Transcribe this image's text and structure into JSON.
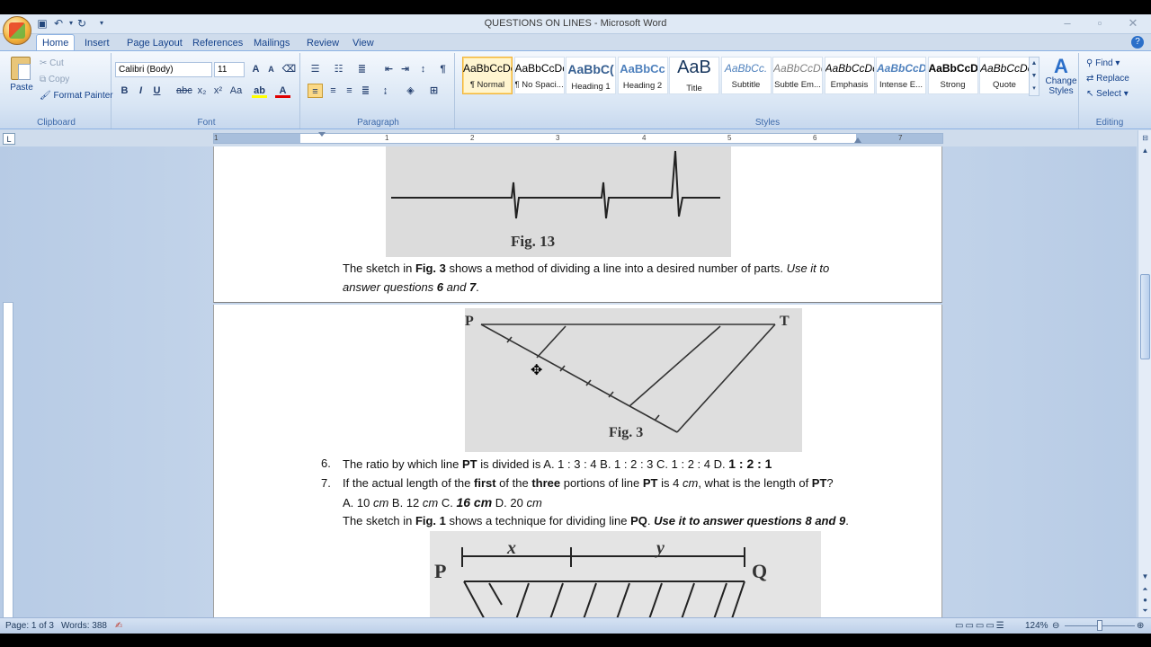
{
  "window": {
    "title": "QUESTIONS ON LINES - Microsoft Word"
  },
  "ribbon_tabs": [
    "Home",
    "Insert",
    "Page Layout",
    "References",
    "Mailings",
    "Review",
    "View"
  ],
  "clipboard": {
    "paste": "Paste",
    "cut": "Cut",
    "copy": "Copy",
    "format_painter": "Format Painter",
    "label": "Clipboard"
  },
  "font": {
    "family": "Calibri (Body)",
    "size": "11",
    "label": "Font"
  },
  "paragraph": {
    "label": "Paragraph"
  },
  "styles": {
    "label": "Styles",
    "items": [
      {
        "sample": "AaBbCcDc",
        "name": "¶ Normal"
      },
      {
        "sample": "AaBbCcDc",
        "name": "¶ No Spaci..."
      },
      {
        "sample": "AaBbC(",
        "name": "Heading 1"
      },
      {
        "sample": "AaBbCc",
        "name": "Heading 2"
      },
      {
        "sample": "AaB",
        "name": "Title"
      },
      {
        "sample": "AaBbCc.",
        "name": "Subtitle"
      },
      {
        "sample": "AaBbCcDc",
        "name": "Subtle Em..."
      },
      {
        "sample": "AaBbCcDc",
        "name": "Emphasis"
      },
      {
        "sample": "AaBbCcDc",
        "name": "Intense E..."
      },
      {
        "sample": "AaBbCcDc",
        "name": "Strong"
      },
      {
        "sample": "AaBbCcDc",
        "name": "Quote"
      }
    ],
    "change_styles": "Change Styles"
  },
  "editing": {
    "find": "Find",
    "replace": "Replace",
    "select": "Select",
    "label": "Editing"
  },
  "document": {
    "fig13_caption": "Fig. 13",
    "line1": {
      "a": "The sketch in ",
      "b": "Fig. 3",
      "c": " shows a method of dividing  a line into a desired number  of parts. ",
      "d": "Use it to"
    },
    "line2": {
      "a": "answer questions ",
      "b": "6",
      "c": " and ",
      "d": "7",
      "e": "."
    },
    "fig3_caption": "Fig. 3",
    "fig3_P": "P",
    "fig3_T": "T",
    "q6": {
      "num": "6.",
      "a": "The ratio by which line ",
      "b": "PT",
      "c": " is divided is A. 1 : 3 : 4 B. 1 : 2 : 3 C. 1 : 2 : 4 D. ",
      "d": "1 : 2 : 1"
    },
    "q7": {
      "num": "7.",
      "a": "If the actual length of the ",
      "b": "first",
      "c": " of the ",
      "d": "three",
      "e": " portions  of line ",
      "f": "PT",
      "g": " is 4 ",
      "h": "cm",
      "i": ", what is the length  of ",
      "j": "PT",
      "k": "?"
    },
    "q7ans": {
      "a": "A. 10 ",
      "b": "cm",
      "c": " B. 12 ",
      "d": "cm",
      "e": " C. ",
      "f": "16 cm",
      "g": " D. 20 ",
      "h": "cm"
    },
    "line3": {
      "a": "The sketch in ",
      "b": "Fig. 1",
      "c": " shows a technique  for dividing  line ",
      "d": "PQ",
      "e": ". ",
      "f": "Use it to answer questions 8 and 9",
      "g": "."
    },
    "fig1_P": "P",
    "fig1_Q": "Q",
    "fig1_x": "x",
    "fig1_y": "y"
  },
  "status": {
    "page": "Page: 1 of 3",
    "words": "Words: 388",
    "zoom": "124%"
  }
}
